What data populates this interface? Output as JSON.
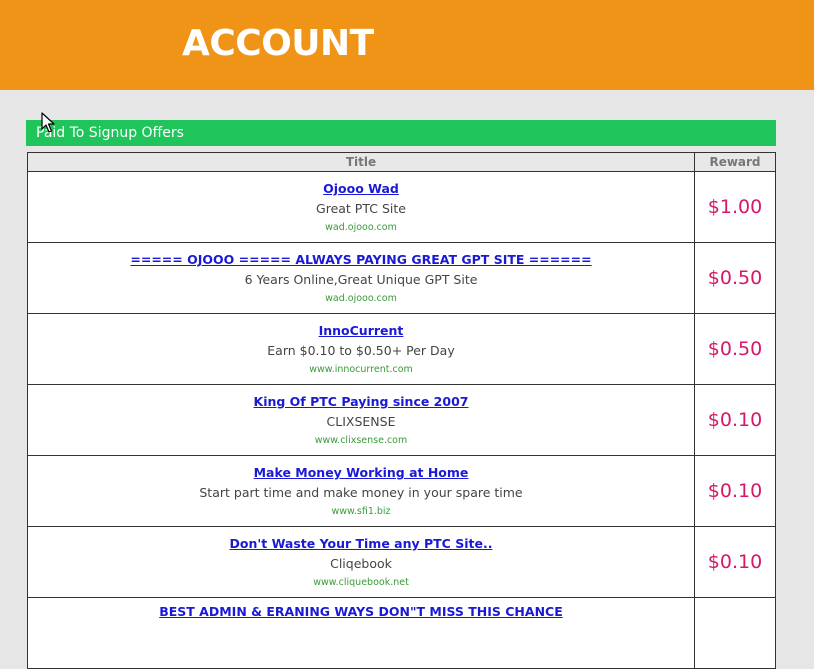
{
  "header": {
    "title": "ACCOUNT"
  },
  "section": {
    "title": "Paid To Signup Offers"
  },
  "table": {
    "columns": [
      "Title",
      "Reward"
    ],
    "rows": [
      {
        "title": "Ojooo Wad",
        "description": "Great PTC Site",
        "url": "wad.ojooo.com",
        "reward": "$1.00"
      },
      {
        "title": "===== OJOOO ===== ALWAYS PAYING GREAT GPT SITE ======",
        "description": "6 Years Online,Great Unique GPT Site",
        "url": "wad.ojooo.com",
        "reward": "$0.50"
      },
      {
        "title": "InnoCurrent",
        "description": "Earn $0.10 to $0.50+ Per Day",
        "url": "www.innocurrent.com",
        "reward": "$0.50"
      },
      {
        "title": "King Of PTC Paying since 2007",
        "description": "CLIXSENSE",
        "url": "www.clixsense.com",
        "reward": "$0.10"
      },
      {
        "title": "Make Money Working at Home",
        "description": "Start part time and make money in your spare time",
        "url": "www.sfi1.biz",
        "reward": "$0.10"
      },
      {
        "title": "Don't Waste Your Time any PTC Site..",
        "description": "Cliqebook",
        "url": "www.cliquebook.net",
        "reward": "$0.10"
      },
      {
        "title": "BEST ADMIN & ERANING WAYS DON\"T MISS THIS CHANCE",
        "description": "",
        "url": "",
        "reward": ""
      }
    ]
  },
  "colors": {
    "header_bg": "#f09418",
    "section_bg": "#1fc45a",
    "link": "#1a1ad6",
    "reward": "#d6186a",
    "url": "#3a9a3a"
  }
}
